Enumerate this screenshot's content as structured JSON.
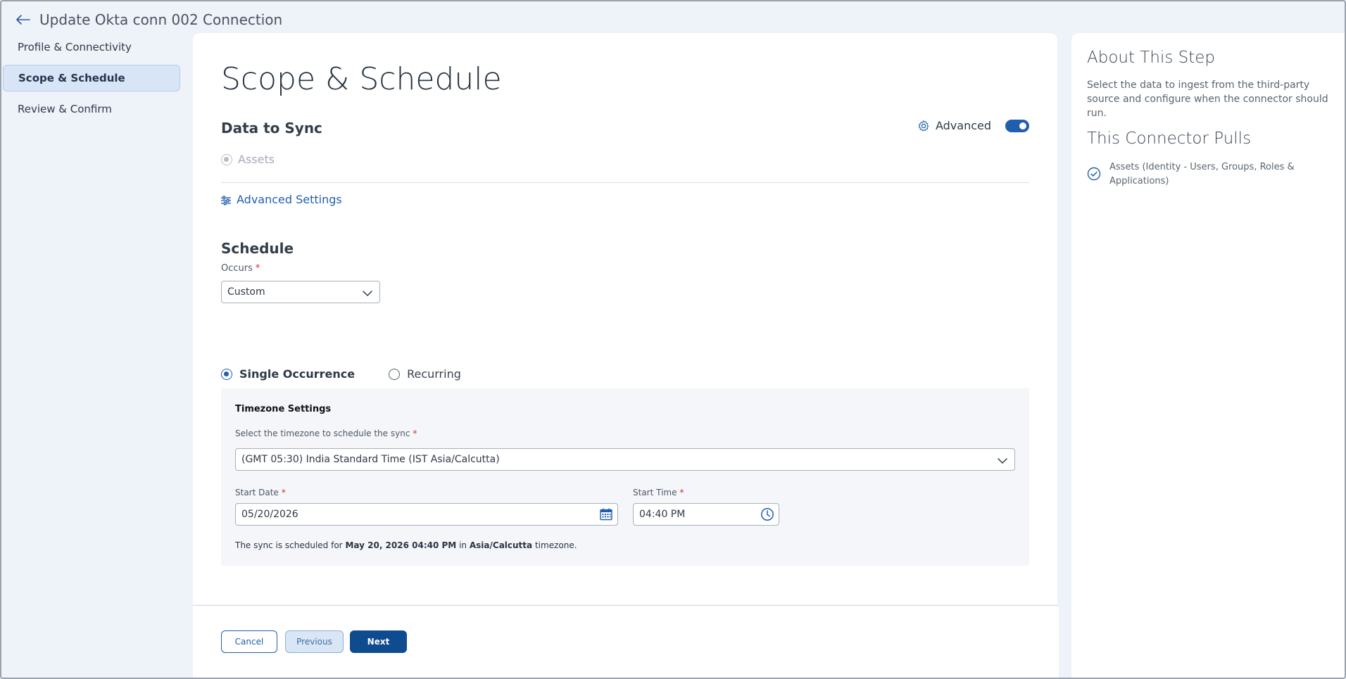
{
  "header": {
    "title": "Update Okta conn 002 Connection",
    "back_icon": "arrow-left-icon"
  },
  "sidebar": {
    "items": [
      {
        "label": "Profile & Connectivity",
        "active": false
      },
      {
        "label": "Scope & Schedule",
        "active": true
      },
      {
        "label": "Review & Confirm",
        "active": false
      }
    ]
  },
  "main": {
    "page_title": "Scope & Schedule",
    "data_to_sync": {
      "heading": "Data to Sync",
      "advanced_label": "Advanced",
      "advanced_enabled": true,
      "assets_label": "Assets"
    },
    "advanced_settings_link": "Advanced Settings",
    "schedule": {
      "heading": "Schedule",
      "occurs_label": "Occurs",
      "occurs_value": "Custom",
      "single_occurrence_label": "Single Occurrence",
      "recurring_label": "Recurring",
      "selected": "single"
    },
    "timezone": {
      "heading": "Timezone Settings",
      "select_label": "Select the timezone to schedule the sync",
      "select_value": "(GMT 05:30) India Standard Time (IST Asia/Calcutta)",
      "start_date_label": "Start Date",
      "start_date_value": "05/20/2026",
      "start_time_label": "Start Time",
      "start_time_value": "04:40 PM",
      "summary_prefix": "The sync is scheduled for",
      "summary_datetime": "May 20, 2026 04:40 PM",
      "summary_in": "in",
      "summary_zone": "Asia/Calcutta",
      "summary_suffix": "timezone."
    },
    "required_marker": "*"
  },
  "footer": {
    "cancel_label": "Cancel",
    "previous_label": "Previous",
    "next_label": "Next"
  },
  "right_panel": {
    "about_title": "About This Step",
    "about_text": "Select the data to ingest from the third-party source and configure when the connector should run.",
    "pulls_title": "This Connector Pulls",
    "pulls_item": "Assets (Identity - Users, Groups, Roles & Applications)"
  },
  "colors": {
    "accent": "#1f5fae",
    "primary_button": "#0f4c8f",
    "required": "#c8312b",
    "background": "#eef2f9"
  }
}
